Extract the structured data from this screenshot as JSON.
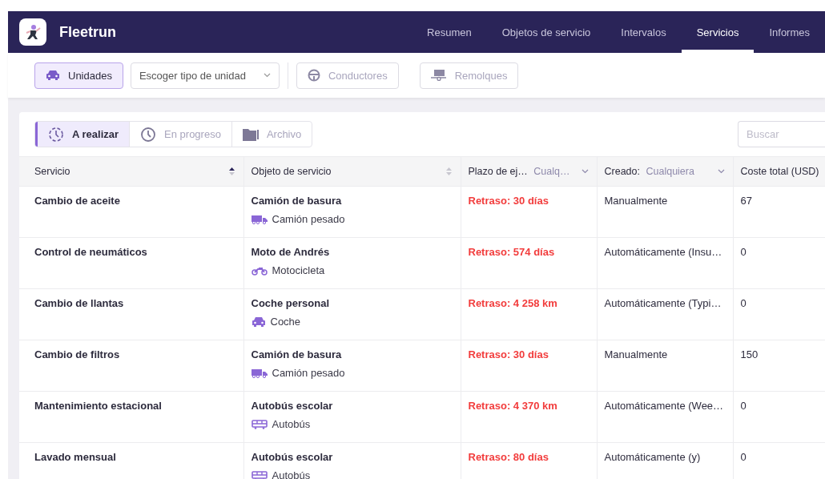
{
  "app": {
    "name": "Fleetrun"
  },
  "nav": [
    {
      "label": "Resumen",
      "selected": false
    },
    {
      "label": "Objetos de servicio",
      "selected": false
    },
    {
      "label": "Intervalos",
      "selected": false
    },
    {
      "label": "Servicios",
      "selected": true
    },
    {
      "label": "Informes",
      "selected": false
    }
  ],
  "toolbar": {
    "units": [
      {
        "label": "Unidades",
        "kind": "car",
        "selected": true
      }
    ],
    "unit_type": {
      "placeholder": "Escoger tipo de unidad"
    },
    "others": [
      {
        "label": "Conductores",
        "kind": "wheel",
        "selected": false
      },
      {
        "label": "Remolques",
        "kind": "trailer",
        "selected": false
      }
    ]
  },
  "tabs": [
    {
      "label": "A realizar",
      "kind": "todo",
      "selected": true
    },
    {
      "label": "En progreso",
      "kind": "clock",
      "selected": false
    },
    {
      "label": "Archivo",
      "kind": "folder",
      "selected": false
    }
  ],
  "search": {
    "placeholder": "Buscar"
  },
  "table": {
    "columns": [
      {
        "label": "Servicio",
        "sorted": true
      },
      {
        "label": "Objeto de servicio",
        "sorted": false
      },
      {
        "label": "Plazo de ej…",
        "filter": "Cualq…"
      },
      {
        "label": "Creado:",
        "filter": "Cualquiera"
      },
      {
        "label": "Coste total (USD)"
      }
    ],
    "rows": [
      {
        "service": "Cambio de aceite",
        "object": "Camión de basura",
        "type": "Camión pesado",
        "kind": "truck",
        "deadline": "Retraso: 30 días",
        "created": "Manualmente",
        "cost": "67"
      },
      {
        "service": "Control de neumáticos",
        "object": "Moto de Andrés",
        "type": "Motocicleta",
        "kind": "moto",
        "deadline": "Retraso: 574 días",
        "created": "Automáticamente (Insu…",
        "cost": "0"
      },
      {
        "service": "Cambio de llantas",
        "object": "Coche personal",
        "type": "Coche",
        "kind": "car",
        "deadline": "Retraso: 4 258 km",
        "created": "Automáticamente (Typi…",
        "cost": "0"
      },
      {
        "service": "Cambio de filtros",
        "object": "Camión de basura",
        "type": "Camión pesado",
        "kind": "truck",
        "deadline": "Retraso: 30 días",
        "created": "Manualmente",
        "cost": "150"
      },
      {
        "service": "Mantenimiento estacional",
        "object": "Autobús escolar",
        "type": "Autobús",
        "kind": "bus",
        "deadline": "Retraso: 4 370 km",
        "created": "Automáticamente (Wee…",
        "cost": "0"
      },
      {
        "service": "Lavado mensual",
        "object": "Autobús escolar",
        "type": "Autobús",
        "kind": "bus",
        "deadline": "Retraso: 80 días",
        "created": "Automáticamente (y)",
        "cost": "0"
      }
    ]
  }
}
